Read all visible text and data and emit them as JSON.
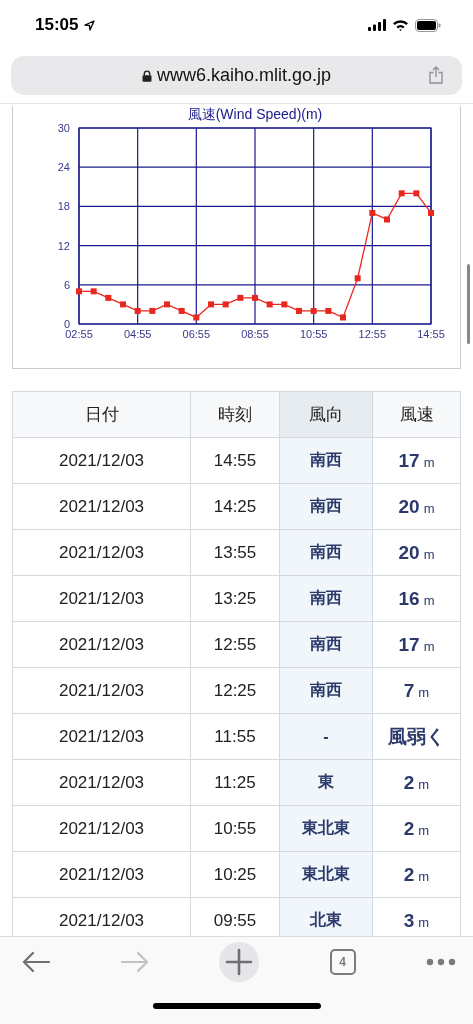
{
  "status_bar": {
    "time": "15:05"
  },
  "address_bar": {
    "url": "www6.kaiho.mlit.go.jp"
  },
  "chart": {
    "chart_data": {
      "type": "line",
      "title": "風速(Wind Speed)(m)",
      "x": [
        2.9167,
        3.4167,
        3.9167,
        4.4167,
        4.9167,
        5.4167,
        5.9167,
        6.4167,
        6.9167,
        7.4167,
        7.9167,
        8.4167,
        8.9167,
        9.4167,
        9.9167,
        10.4167,
        10.9167,
        11.4167,
        11.9167,
        12.4167,
        12.9167,
        13.4167,
        13.9167,
        14.4167,
        14.9167
      ],
      "xlim": [
        2.9167,
        14.9167
      ],
      "grid": true,
      "series": [
        {
          "color": "#e8281e",
          "marker": "square",
          "values": [
            5,
            5,
            4,
            3,
            2,
            2,
            3,
            2,
            1,
            3,
            3,
            4,
            4,
            3,
            3,
            2,
            2,
            2,
            1,
            7,
            17,
            16,
            20,
            20,
            17
          ]
        }
      ],
      "ylim": [
        0,
        30
      ],
      "yticks": [
        0,
        6,
        12,
        18,
        24,
        30
      ],
      "xticks": [
        {
          "value": 2.9167,
          "label": "02:55"
        },
        {
          "value": 4.9167,
          "label": "04:55"
        },
        {
          "value": 6.9167,
          "label": "06:55"
        },
        {
          "value": 8.9167,
          "label": "08:55"
        },
        {
          "value": 10.9167,
          "label": "10:55"
        },
        {
          "value": 12.9167,
          "label": "12:55"
        },
        {
          "value": 14.9167,
          "label": "14:55"
        }
      ]
    }
  },
  "table": {
    "columns": [
      {
        "label": "日付",
        "highlighted": false
      },
      {
        "label": "時刻",
        "highlighted": false
      },
      {
        "label": "風向",
        "highlighted": true
      },
      {
        "label": "風速",
        "highlighted": false
      }
    ],
    "rows": [
      {
        "date": "2021/12/03",
        "time": "14:55",
        "direction": "南西",
        "speed": "17",
        "unit": "m"
      },
      {
        "date": "2021/12/03",
        "time": "14:25",
        "direction": "南西",
        "speed": "20",
        "unit": "m"
      },
      {
        "date": "2021/12/03",
        "time": "13:55",
        "direction": "南西",
        "speed": "20",
        "unit": "m"
      },
      {
        "date": "2021/12/03",
        "time": "13:25",
        "direction": "南西",
        "speed": "16",
        "unit": "m"
      },
      {
        "date": "2021/12/03",
        "time": "12:55",
        "direction": "南西",
        "speed": "17",
        "unit": "m"
      },
      {
        "date": "2021/12/03",
        "time": "12:25",
        "direction": "南西",
        "speed": "7",
        "unit": "m"
      },
      {
        "date": "2021/12/03",
        "time": "11:55",
        "direction": "-",
        "speed": "風弱く"
      },
      {
        "date": "2021/12/03",
        "time": "11:25",
        "direction": "東",
        "speed": "2",
        "unit": "m"
      },
      {
        "date": "2021/12/03",
        "time": "10:55",
        "direction": "東北東",
        "speed": "2",
        "unit": "m"
      },
      {
        "date": "2021/12/03",
        "time": "10:25",
        "direction": "東北東",
        "speed": "2",
        "unit": "m"
      },
      {
        "date": "2021/12/03",
        "time": "09:55",
        "direction": "北東",
        "speed": "3",
        "unit": "m"
      }
    ]
  },
  "toolbar": {
    "tab_count": "4",
    "back_disabled": false,
    "forward_disabled": true
  }
}
